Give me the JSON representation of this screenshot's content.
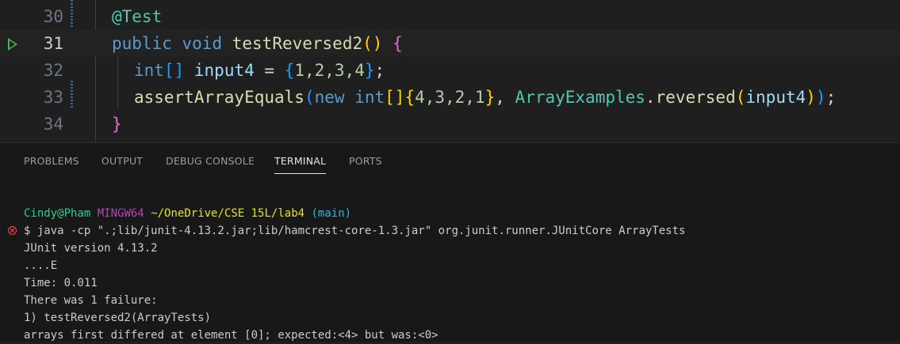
{
  "editor": {
    "lines": [
      {
        "number": "30"
      },
      {
        "number": "31"
      },
      {
        "number": "32"
      },
      {
        "number": "33"
      },
      {
        "number": "34"
      }
    ],
    "code": {
      "l30": {
        "annotation": "@Test"
      },
      "l31": {
        "kw_public": "public",
        "kw_void": "void",
        "method": "testReversed2",
        "paren_open": "(",
        "paren_close": ")",
        "brace": "{"
      },
      "l32": {
        "type": "int",
        "brackets": "[]",
        "var": "input4",
        "eq": " = ",
        "brace_open": "{",
        "values": "1,2,3,4",
        "brace_close": "}",
        "semi": ";"
      },
      "l33": {
        "call": "assertArrayEquals",
        "p_open": "(",
        "kw_new": "new",
        "type": "int",
        "brackets": "[]",
        "b_open": "{",
        "values": "4,3,2,1",
        "b_close": "}",
        "comma": ", ",
        "cls": "ArrayExamples",
        "dot": ".",
        "method": "reversed",
        "p2_open": "(",
        "arg": "input4",
        "p2_close": ")",
        "p_close": ")",
        "semi": ";"
      },
      "l34": {
        "brace": "}"
      }
    }
  },
  "panel": {
    "tabs": [
      "PROBLEMS",
      "OUTPUT",
      "DEBUG CONSOLE",
      "TERMINAL",
      "PORTS"
    ],
    "active_tab": "TERMINAL"
  },
  "terminal": {
    "prompt": {
      "user": "Cindy@Pham",
      "host": "MINGW64",
      "path": "~/OneDrive/CSE 15L/lab4",
      "branch": "(main)"
    },
    "command": "$ java -cp \".;lib/junit-4.13.2.jar;lib/hamcrest-core-1.3.jar\" org.junit.runner.JUnitCore ArrayTests",
    "output": [
      "JUnit version 4.13.2",
      "....E",
      "Time: 0.011",
      "There was 1 failure:",
      "1) testReversed2(ArrayTests)",
      "arrays first differed at element [0]; expected:<4> but was:<0>"
    ]
  },
  "colors": {
    "editor_bg": "#1f1f1f",
    "panel_bg": "#181818",
    "keyword": "#569cd6",
    "type": "#4ec9b0",
    "function": "#dcdcaa",
    "prompt_user": "#23d18b",
    "prompt_host": "#bc3fbc",
    "prompt_path": "#e5e510",
    "prompt_branch": "#29b8db",
    "error": "#f14c4c"
  },
  "icons": [
    "run-test-icon",
    "error-circle-icon"
  ]
}
